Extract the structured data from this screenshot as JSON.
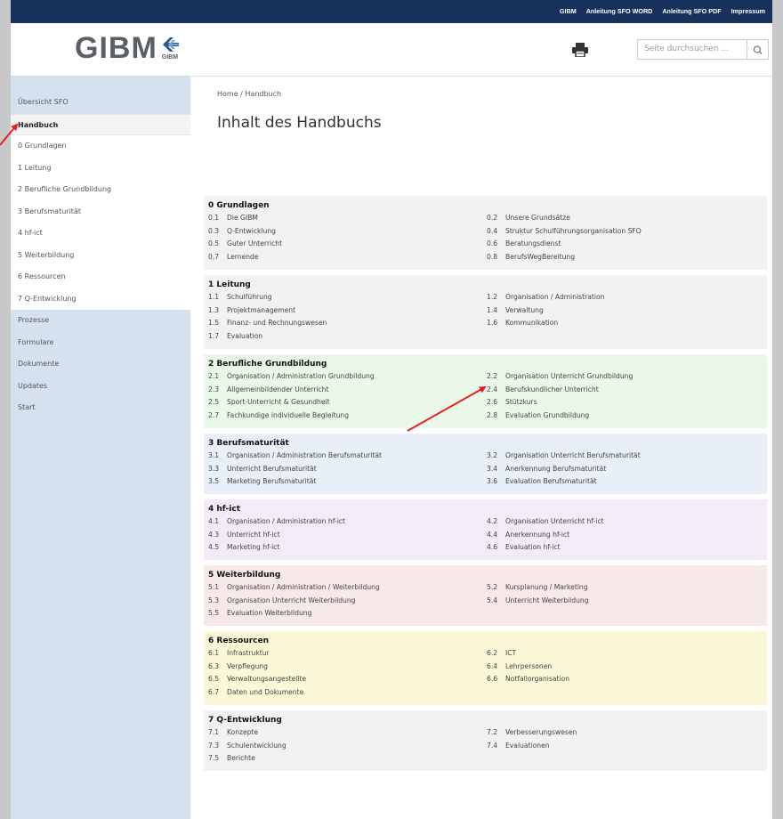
{
  "topbar": {
    "links": [
      "GIBM",
      "Anleitung SFO WORD",
      "Anleitung SFO PDF",
      "Impressum"
    ]
  },
  "header": {
    "logo_text": "GIBM",
    "logo_sub": "GIBM",
    "print_icon": "printer-icon",
    "search_placeholder": "Seite durchsuchen ...",
    "search_icon": "search-icon"
  },
  "sidebar": {
    "items": [
      {
        "label": "Übersicht SFO",
        "kind": "normal"
      },
      {
        "label": "Handbuch",
        "kind": "active"
      },
      {
        "label": "0  Grundlagen",
        "kind": "sub"
      },
      {
        "label": "1  Leitung",
        "kind": "sub"
      },
      {
        "label": "2  Berufliche Grundbildung",
        "kind": "sub"
      },
      {
        "label": "3  Berufsmaturität",
        "kind": "sub"
      },
      {
        "label": "4  hf-ict",
        "kind": "sub"
      },
      {
        "label": "5  Weiterbildung",
        "kind": "sub"
      },
      {
        "label": "6  Ressourcen",
        "kind": "sub"
      },
      {
        "label": "7  Q-Entwicklung",
        "kind": "sub"
      },
      {
        "label": "Prozesse",
        "kind": "normal"
      },
      {
        "label": "Formulare",
        "kind": "normal"
      },
      {
        "label": "Dokumente",
        "kind": "normal"
      },
      {
        "label": "Updates",
        "kind": "normal"
      },
      {
        "label": "Start",
        "kind": "normal"
      }
    ]
  },
  "main": {
    "breadcrumb": "Home / Handbuch",
    "title": "Inhalt des Handbuchs",
    "sections": [
      {
        "title": "0  Grundlagen",
        "color": "#f2f2f2",
        "entries": [
          [
            "0.1",
            "Die GIBM"
          ],
          [
            "0.2",
            "Unsere Grundsätze"
          ],
          [
            "0.3",
            "Q-Entwicklung"
          ],
          [
            "0.4",
            "Struktur Schulführungsorganisation SFO"
          ],
          [
            "0.5",
            "Guter Unterricht"
          ],
          [
            "0.6",
            "Beratungsdienst"
          ],
          [
            "0.7",
            "Lernende"
          ],
          [
            "0.8",
            "BerufsWegBereitung"
          ]
        ]
      },
      {
        "title": "1  Leitung",
        "color": "#f2f2f2",
        "entries": [
          [
            "1.1",
            "Schulführung"
          ],
          [
            "1.2",
            "Organisation / Administration"
          ],
          [
            "1.3",
            "Projektmanagement"
          ],
          [
            "1.4",
            "Verwaltung"
          ],
          [
            "1.5",
            "Finanz- und Rechnungswesen"
          ],
          [
            "1.6",
            "Kommunikation"
          ],
          [
            "1.7",
            "Evaluation"
          ]
        ]
      },
      {
        "title": "2  Berufliche Grundbildung",
        "color": "#eaf8ea",
        "entries": [
          [
            "2.1",
            "Organisation / Administration Grundbildung"
          ],
          [
            "2.2",
            "Organisation Unterricht Grundbildung"
          ],
          [
            "2.3",
            "Allgemeinbildender Unterricht"
          ],
          [
            "2.4",
            "Berufskundlicher Unterricht"
          ],
          [
            "2.5",
            "Sport-Unterricht & Gesundheit"
          ],
          [
            "2.6",
            "Stützkurs"
          ],
          [
            "2.7",
            "Fachkundige individuelle Begleitung"
          ],
          [
            "2.8",
            "Evaluation Grundbildung"
          ]
        ]
      },
      {
        "title": "3  Berufsmaturität",
        "color": "#e8eff8",
        "entries": [
          [
            "3.1",
            "Organisation / Administration Berufsmaturität"
          ],
          [
            "3.2",
            "Organisation Unterricht Berufsmaturität"
          ],
          [
            "3.3",
            "Unterricht Berufsmaturität"
          ],
          [
            "3.4",
            "Anerkennung Berufsmaturität"
          ],
          [
            "3.5",
            "Marketing Berufsmaturität"
          ],
          [
            "3.6",
            "Evaluation Berufsmaturität"
          ]
        ]
      },
      {
        "title": "4  hf-ict",
        "color": "#f3ebf8",
        "entries": [
          [
            "4.1",
            "Organisation / Administration hf-ict"
          ],
          [
            "4.2",
            "Organisation Unterricht hf-ict"
          ],
          [
            "4.3",
            "Unterricht hf-ict"
          ],
          [
            "4.4",
            "Anerkennung hf-ict"
          ],
          [
            "4.5",
            "Marketing hf-ict"
          ],
          [
            "4.6",
            "Evaluation hf-ict"
          ]
        ]
      },
      {
        "title": "5  Weiterbildung",
        "color": "#f8e9e9",
        "entries": [
          [
            "5.1",
            "Organisation / Administration / Weiterbildung"
          ],
          [
            "5.2",
            "Kursplanung / Marketing"
          ],
          [
            "5.3",
            "Organisation Unterricht Weiterbildung"
          ],
          [
            "5.4",
            "Unterricht Weiterbildung"
          ],
          [
            "5.5",
            "Evaluation Weiterbildung"
          ]
        ]
      },
      {
        "title": "6  Ressourcen",
        "color": "#fbf8d8",
        "entries": [
          [
            "6.1",
            "Infrastruktur"
          ],
          [
            "6.2",
            "ICT"
          ],
          [
            "6.3",
            "Verpflegung"
          ],
          [
            "6.4",
            "Lehrpersonen"
          ],
          [
            "6.5",
            "Verwaltungsangestellte"
          ],
          [
            "6.6",
            "Notfallorganisation"
          ],
          [
            "6.7",
            "Daten und Dokumente"
          ]
        ]
      },
      {
        "title": "7  Q-Entwicklung",
        "color": "#f2f2f2",
        "entries": [
          [
            "7.1",
            "Konzepte"
          ],
          [
            "7.2",
            "Verbesserungswesen"
          ],
          [
            "7.3",
            "Schulentwicklung"
          ],
          [
            "7.4",
            "Evaluationen"
          ],
          [
            "7.5",
            "Berichte"
          ]
        ]
      }
    ]
  }
}
